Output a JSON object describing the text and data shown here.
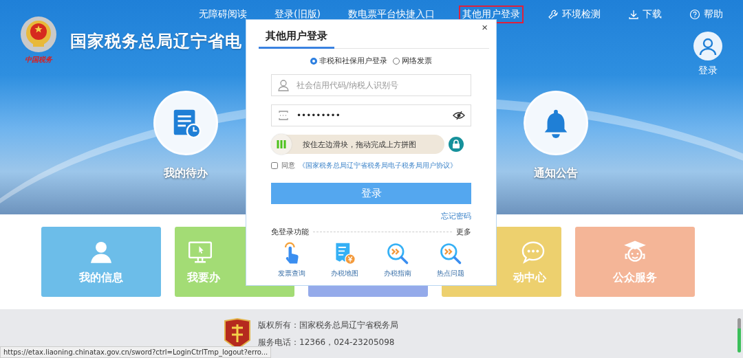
{
  "header": {
    "logo_caption": "中国税务",
    "site_title": "国家税务总局辽宁省电",
    "nav": [
      {
        "label": "无障碍阅读",
        "highlighted": false
      },
      {
        "label": "登录(旧版)",
        "highlighted": false
      },
      {
        "label": "数电票平台快捷入口",
        "highlighted": false
      },
      {
        "label": "其他用户登录",
        "highlighted": true
      },
      {
        "label": "环境检测",
        "kind": "wrench",
        "highlighted": false
      },
      {
        "label": "下载",
        "kind": "download",
        "highlighted": false
      },
      {
        "label": "帮助",
        "kind": "help",
        "highlighted": false
      }
    ],
    "login": {
      "label": "登录"
    }
  },
  "quick_tiles": [
    {
      "label": "我的待办",
      "kind": "clipboard"
    },
    {
      "label": "通知公告",
      "kind": "bell"
    }
  ],
  "cards": [
    {
      "label": "我的信息",
      "kind": "person",
      "color": "#6cbde9"
    },
    {
      "label": "我要办",
      "kind": "monitor",
      "color": "#a3dc75"
    },
    {
      "kind": "blank",
      "color": "#94aaea"
    },
    {
      "label": "动中心",
      "kind": "chat",
      "color": "#edd06e"
    },
    {
      "label": "公众服务",
      "kind": "graduate",
      "color": "#f4b597"
    }
  ],
  "modal": {
    "tabs": [
      {
        "label": "其他用户登录",
        "selected": true
      }
    ],
    "close": "×",
    "radios": [
      {
        "label": "非税和社保用户登录",
        "selected": true
      },
      {
        "label": "网络发票",
        "selected": false
      }
    ],
    "account_field": {
      "placeholder": "社会信用代码/纳税人识别号"
    },
    "password_field": {
      "value": "•••••••••"
    },
    "slider": {
      "label": "按住左边滑块，拖动完成上方拼图",
      "level": 0
    },
    "agree": {
      "checked": false,
      "text": "同意",
      "link": "《国家税务总局辽宁省税务局电子税务局用户协议》"
    },
    "login_button": "登录",
    "forgot": "忘记密码",
    "shortcuts_title": "免登录功能",
    "more": "更多",
    "shortcuts": [
      {
        "label": "发票查询",
        "kind": "tap"
      },
      {
        "label": "办税地图",
        "kind": "receipt"
      },
      {
        "label": "办税指南",
        "kind": "search"
      },
      {
        "label": "热点问题",
        "kind": "search"
      }
    ]
  },
  "footer": {
    "copyright": "版权所有：国家税务总局辽宁省税务局",
    "phone": "服务电话：12366，024-23205098"
  },
  "status_url": "https://etax.liaoning.chinatax.gov.cn/sword?ctrl=LoginCtrlTmp_logout?erro..."
}
